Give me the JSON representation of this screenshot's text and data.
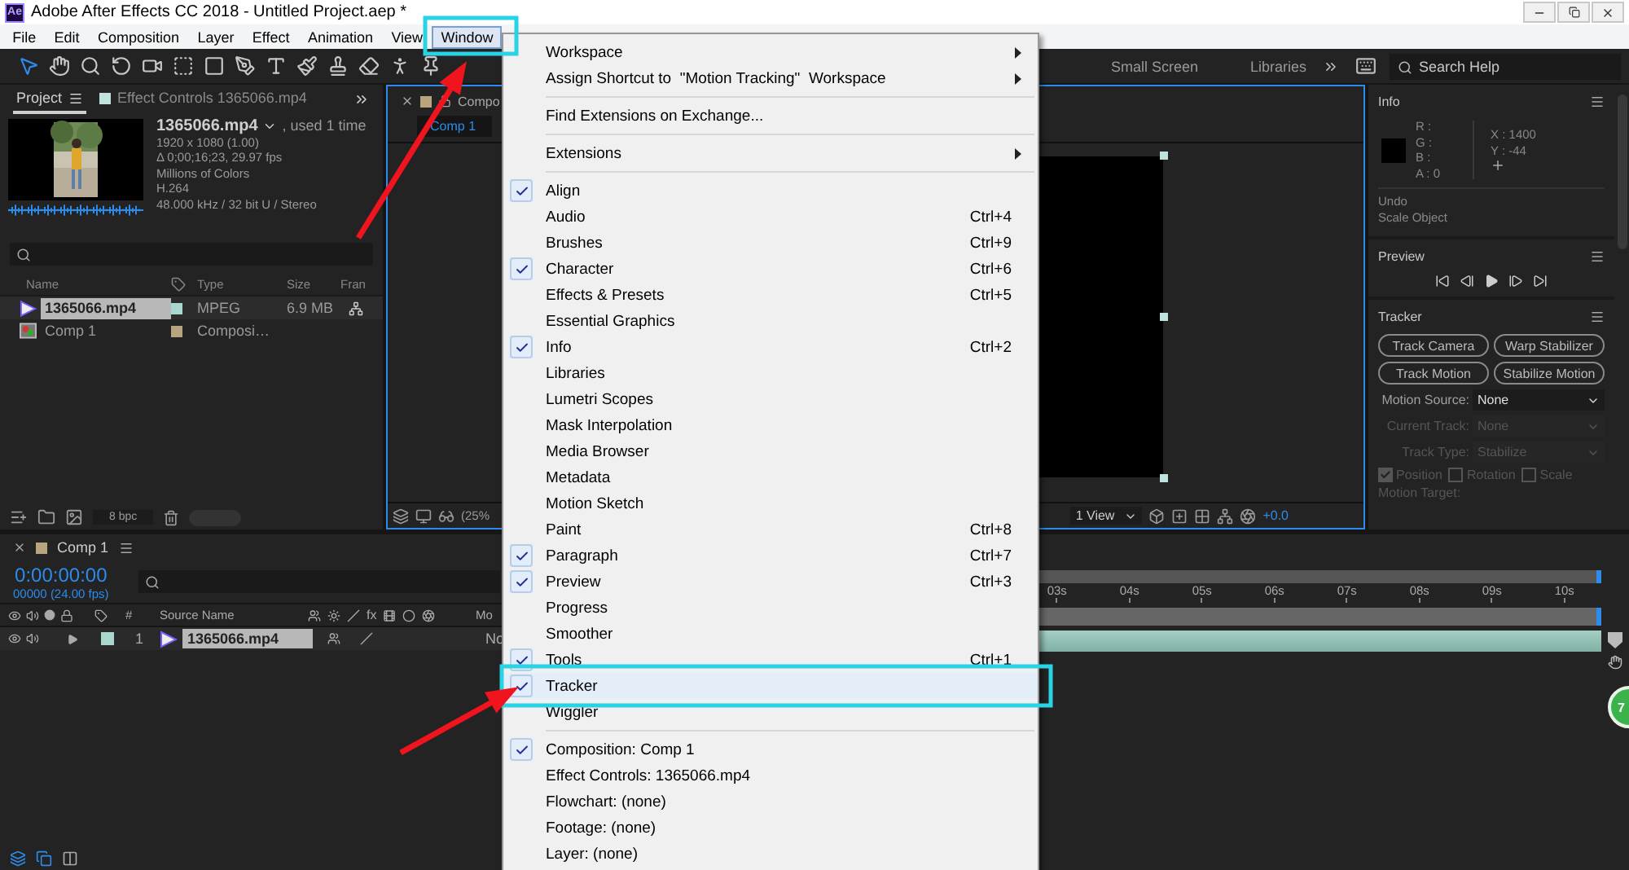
{
  "window": {
    "app_icon": "Ae",
    "title": "Adobe After Effects CC 2018 - Untitled Project.aep *"
  },
  "menu_bar": [
    {
      "label": "File",
      "selected": false
    },
    {
      "label": "Edit",
      "selected": false
    },
    {
      "label": "Composition",
      "selected": false
    },
    {
      "label": "Layer",
      "selected": false
    },
    {
      "label": "Effect",
      "selected": false
    },
    {
      "label": "Animation",
      "selected": false
    },
    {
      "label": "View",
      "selected": false
    },
    {
      "label": "Window",
      "selected": true
    }
  ],
  "tools": [
    {
      "kind": "selection",
      "selected": true
    },
    {
      "kind": "hand",
      "selected": false
    },
    {
      "kind": "zoom",
      "selected": false
    },
    {
      "kind": "rotate",
      "selected": false
    },
    {
      "kind": "camera",
      "selected": false
    },
    {
      "kind": "pan-behind",
      "selected": false
    },
    {
      "kind": "rectangle",
      "selected": false
    },
    {
      "kind": "pen",
      "selected": false
    },
    {
      "kind": "type",
      "selected": false
    },
    {
      "kind": "brush",
      "selected": false
    },
    {
      "kind": "stamp",
      "selected": false
    },
    {
      "kind": "eraser",
      "selected": false
    },
    {
      "kind": "roto",
      "selected": false
    },
    {
      "kind": "puppet",
      "selected": false
    }
  ],
  "workspaces": [
    "Small Screen",
    "Libraries"
  ],
  "search": {
    "placeholder": "Search Help"
  },
  "project_panel": {
    "tabs": [
      {
        "label": "Project",
        "selected": true
      },
      {
        "label": "Effect Controls 1365066.mp4",
        "selected": false
      }
    ],
    "footage": {
      "name": "1365066.mp4",
      "usage": ", used 1 time",
      "details": [
        "1920 x 1080 (1.00)",
        "Δ 0;00;16;23, 29.97 fps",
        "Millions of Colors",
        "H.264",
        "48.000 kHz / 32 bit U / Stereo"
      ]
    },
    "columns": [
      "Name",
      "Type",
      "Size",
      "Fran"
    ],
    "items": [
      {
        "kind": "footage",
        "name": "1365066.mp4",
        "color": "#a9d6cf",
        "type": "MPEG",
        "size": "6.9 MB",
        "selected": true
      },
      {
        "kind": "composition",
        "name": "Comp 1",
        "color": "#b8a47e",
        "type": "Composi…",
        "selected": false
      }
    ],
    "bit_depth": "8 bpc"
  },
  "composition_panel": {
    "tab": "Compo",
    "chip": "Comp 1",
    "zoom": "(25%",
    "view": "1 View",
    "exposure": "+0.0"
  },
  "info_panel": {
    "title": "Info",
    "channels": [
      "R :",
      "G :",
      "B :",
      "A :  0"
    ],
    "x": "X : 1400",
    "y": "Y :  -44",
    "undo": "Undo",
    "undo_action": "Scale Object"
  },
  "preview_panel": {
    "title": "Preview"
  },
  "tracker_panel": {
    "title": "Tracker",
    "buttons": [
      "Track Camera",
      "Warp Stabilizer",
      "Track Motion",
      "Stabilize Motion"
    ],
    "fields": [
      {
        "label": "Motion Source:",
        "value": "None",
        "disabled": false
      },
      {
        "label": "Current Track:",
        "value": "None",
        "disabled": true
      },
      {
        "label": "Track Type:",
        "value": "Stabilize",
        "disabled": true
      }
    ],
    "options": [
      {
        "label": "Position",
        "checked": true,
        "disabled": true
      },
      {
        "label": "Rotation",
        "checked": false,
        "disabled": true
      },
      {
        "label": "Scale",
        "checked": false,
        "disabled": true
      }
    ],
    "motion_target": "Motion Target:"
  },
  "timeline": {
    "tab": "Comp 1",
    "time": "0:00:00:00",
    "frames": "00000 (24.00 fps)",
    "number_column": "#",
    "source_column": "Source Name",
    "fx": "fx",
    "mode_column": "Mo",
    "layer": {
      "number": "1",
      "name": "1365066.mp4",
      "mode": "No",
      "color": "#a9d6cf"
    },
    "ticks": [
      "03s",
      "04s",
      "05s",
      "06s",
      "07s",
      "08s",
      "09s",
      "10s"
    ]
  },
  "badge": "7",
  "window_menu": {
    "items": [
      {
        "kind": "submenu",
        "label": "Workspace"
      },
      {
        "kind": "submenu",
        "label": "Assign Shortcut to  \"Motion Tracking\"  Workspace"
      },
      {
        "kind": "separator"
      },
      {
        "kind": "item",
        "label": "Find Extensions on Exchange...",
        "checked": false,
        "selected": false
      },
      {
        "kind": "separator"
      },
      {
        "kind": "submenu",
        "label": "Extensions"
      },
      {
        "kind": "separator"
      },
      {
        "kind": "item",
        "label": "Align",
        "checked": true,
        "selected": false
      },
      {
        "kind": "item",
        "label": "Audio",
        "shortcut": "Ctrl+4",
        "checked": false,
        "selected": false
      },
      {
        "kind": "item",
        "label": "Brushes",
        "shortcut": "Ctrl+9",
        "checked": false,
        "selected": false
      },
      {
        "kind": "item",
        "label": "Character",
        "shortcut": "Ctrl+6",
        "checked": true,
        "selected": false
      },
      {
        "kind": "item",
        "label": "Effects & Presets",
        "shortcut": "Ctrl+5",
        "checked": false,
        "selected": false
      },
      {
        "kind": "item",
        "label": "Essential Graphics",
        "checked": false,
        "selected": false
      },
      {
        "kind": "item",
        "label": "Info",
        "shortcut": "Ctrl+2",
        "checked": true,
        "selected": false
      },
      {
        "kind": "item",
        "label": "Libraries",
        "checked": false,
        "selected": false
      },
      {
        "kind": "item",
        "label": "Lumetri Scopes",
        "checked": false,
        "selected": false
      },
      {
        "kind": "item",
        "label": "Mask Interpolation",
        "checked": false,
        "selected": false
      },
      {
        "kind": "item",
        "label": "Media Browser",
        "checked": false,
        "selected": false
      },
      {
        "kind": "item",
        "label": "Metadata",
        "checked": false,
        "selected": false
      },
      {
        "kind": "item",
        "label": "Motion Sketch",
        "checked": false,
        "selected": false
      },
      {
        "kind": "item",
        "label": "Paint",
        "shortcut": "Ctrl+8",
        "checked": false,
        "selected": false
      },
      {
        "kind": "item",
        "label": "Paragraph",
        "shortcut": "Ctrl+7",
        "checked": true,
        "selected": false
      },
      {
        "kind": "item",
        "label": "Preview",
        "shortcut": "Ctrl+3",
        "checked": true,
        "selected": false
      },
      {
        "kind": "item",
        "label": "Progress",
        "checked": false,
        "selected": false
      },
      {
        "kind": "item",
        "label": "Smoother",
        "checked": false,
        "selected": false
      },
      {
        "kind": "item",
        "label": "Tools",
        "shortcut": "Ctrl+1",
        "checked": true,
        "selected": false
      },
      {
        "kind": "item",
        "label": "Tracker",
        "checked": true,
        "selected": true
      },
      {
        "kind": "item",
        "label": "Wiggler",
        "checked": false,
        "selected": false
      },
      {
        "kind": "separator"
      },
      {
        "kind": "item",
        "label": "Composition: Comp 1",
        "checked": true,
        "selected": false
      },
      {
        "kind": "item",
        "label": "Effect Controls: 1365066.mp4",
        "checked": false,
        "selected": false
      },
      {
        "kind": "item",
        "label": "Flowchart: (none)",
        "checked": false,
        "selected": false
      },
      {
        "kind": "item",
        "label": "Footage: (none)",
        "checked": false,
        "selected": false
      },
      {
        "kind": "item",
        "label": "Layer: (none)",
        "checked": false,
        "selected": false
      }
    ]
  }
}
